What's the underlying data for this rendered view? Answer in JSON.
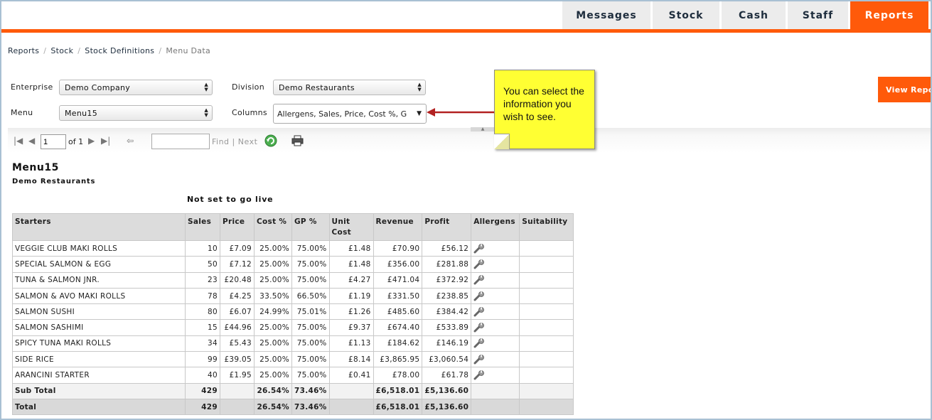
{
  "nav": {
    "tabs": [
      {
        "label": "Messages"
      },
      {
        "label": "Stock"
      },
      {
        "label": "Cash"
      },
      {
        "label": "Staff"
      },
      {
        "label": "Reports"
      }
    ]
  },
  "breadcrumb": [
    "Reports",
    "Stock",
    "Stock Definitions",
    "Menu Data"
  ],
  "filters": {
    "enterprise_label": "Enterprise",
    "enterprise_value": "Demo Company",
    "division_label": "Division",
    "division_value": "Demo Restaurants",
    "menu_label": "Menu",
    "menu_value": "Menu15",
    "columns_label": "Columns",
    "columns_value": "Allergens, Sales, Price, Cost %, G",
    "view_button": "View Report"
  },
  "toolbar": {
    "page_value": "1",
    "of_text": "of 1",
    "find_label": "Find",
    "next_label": "Next",
    "separator": "|"
  },
  "callout": {
    "text": "You can select the information you wish to see."
  },
  "report": {
    "title": "Menu15",
    "subtitle": "Demo Restaurants",
    "status": "Not set to go live",
    "columns": [
      "Starters",
      "Sales",
      "Price",
      "Cost %",
      "GP %",
      "Unit Cost",
      "Revenue",
      "Profit",
      "Allergens",
      "Suitability"
    ],
    "rows": [
      {
        "name": "VEGGIE CLUB MAKI ROLLS",
        "sales": "10",
        "price": "£7.09",
        "cost": "25.00%",
        "gp": "75.00%",
        "unit": "£1.48",
        "revenue": "£70.90",
        "profit": "£56.12"
      },
      {
        "name": "SPECIAL SALMON & EGG",
        "sales": "50",
        "price": "£7.12",
        "cost": "25.00%",
        "gp": "75.00%",
        "unit": "£1.48",
        "revenue": "£356.00",
        "profit": "£281.88"
      },
      {
        "name": "TUNA & SALMON JNR.",
        "sales": "23",
        "price": "£20.48",
        "cost": "25.00%",
        "gp": "75.00%",
        "unit": "£4.27",
        "revenue": "£471.04",
        "profit": "£372.92"
      },
      {
        "name": "SALMON & AVO MAKI ROLLS",
        "sales": "78",
        "price": "£4.25",
        "cost": "33.50%",
        "gp": "66.50%",
        "unit": "£1.19",
        "revenue": "£331.50",
        "profit": "£238.85"
      },
      {
        "name": "SALMON SUSHI",
        "sales": "80",
        "price": "£6.07",
        "cost": "24.99%",
        "gp": "75.01%",
        "unit": "£1.26",
        "revenue": "£485.60",
        "profit": "£384.42"
      },
      {
        "name": "SALMON SASHIMI",
        "sales": "15",
        "price": "£44.96",
        "cost": "25.00%",
        "gp": "75.00%",
        "unit": "£9.37",
        "revenue": "£674.40",
        "profit": "£533.89"
      },
      {
        "name": "SPICY TUNA MAKI ROLLS",
        "sales": "34",
        "price": "£5.43",
        "cost": "25.00%",
        "gp": "75.00%",
        "unit": "£1.13",
        "revenue": "£184.62",
        "profit": "£146.19"
      },
      {
        "name": "SIDE RICE",
        "sales": "99",
        "price": "£39.05",
        "cost": "25.00%",
        "gp": "75.00%",
        "unit": "£8.14",
        "revenue": "£3,865.95",
        "profit": "£3,060.54"
      },
      {
        "name": "ARANCINI STARTER",
        "sales": "40",
        "price": "£1.95",
        "cost": "25.00%",
        "gp": "75.00%",
        "unit": "£0.41",
        "revenue": "£78.00",
        "profit": "£61.78"
      }
    ],
    "subtotal": {
      "name": "Sub Total",
      "sales": "429",
      "cost": "26.54%",
      "gp": "73.46%",
      "revenue": "£6,518.01",
      "profit": "£5,136.60"
    },
    "total": {
      "name": "Total",
      "sales": "429",
      "cost": "26.54%",
      "gp": "73.46%",
      "revenue": "£6,518.01",
      "profit": "£5,136.60"
    }
  },
  "colors": {
    "accent": "#ff5a0a",
    "callout": "#ffff33",
    "arrow": "#b22222"
  }
}
